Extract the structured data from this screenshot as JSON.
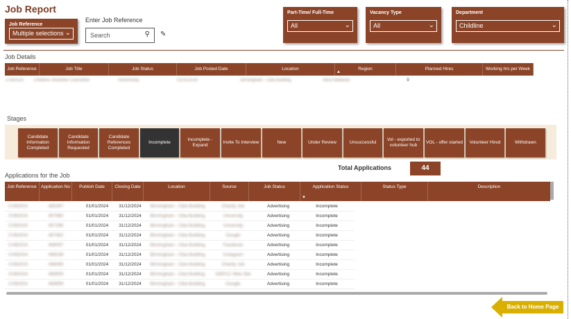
{
  "page": {
    "title": "Job Report",
    "back_label": "Back to Home Page"
  },
  "filters": {
    "job_reference": {
      "label": "Job Reference",
      "value": "Multiple selections"
    },
    "enter_reference_label": "Enter Job Reference",
    "search_placeholder": "Search",
    "part_time": {
      "label": "Part-Time/ Full-Time",
      "value": "All"
    },
    "vacancy_type": {
      "label": "Vacancy Type",
      "value": "All"
    },
    "department": {
      "label": "Department",
      "value": "Childline"
    }
  },
  "job_details": {
    "section_label": "Job Details",
    "columns": [
      "Job Reference",
      "Job Title",
      "Job Status",
      "Job Posted Date",
      "Location",
      "Region",
      "Planned Hires",
      "Working hrs per Week"
    ],
    "row": [
      "CVB2024",
      "Childline Volunteer Counsellor",
      "Advertising",
      "01/01/2024",
      "Birmingham - Ciba Building",
      "West Midlands",
      "0",
      ""
    ]
  },
  "stages": {
    "section_label": "Stages",
    "items": [
      "Candidate Information Completed",
      "Candidate Information Requested",
      "Candidate References Completed",
      "Incomplete",
      "Incomplete - Expand",
      "Invite To Interview",
      "New",
      "Under Review",
      "Unsuccessful",
      "Vol - exported to volunteer hub",
      "VOL - offer started",
      "Volunteer Hired",
      "Withdrawn"
    ],
    "selected": "Incomplete"
  },
  "applications": {
    "section_label": "Applications for the Job",
    "total_label": "Total Applications",
    "total_value": "44",
    "columns": [
      "Job Reference",
      "Application No",
      "Publish Date",
      "Closing Date",
      "Location",
      "Source",
      "Job Status",
      "Application Status",
      "Status Type",
      "Description"
    ],
    "rows": [
      [
        "CVB2024",
        "465497",
        "01/01/2024",
        "31/12/2024",
        "Birmingham - Ciba Building",
        "Charity Job",
        "Advertising",
        "Incomplete",
        "",
        ""
      ],
      [
        "CVB2024",
        "457980",
        "01/01/2024",
        "31/12/2024",
        "Birmingham - Ciba Building",
        "University",
        "Advertising",
        "Incomplete",
        "",
        ""
      ],
      [
        "CVB2024",
        "457285",
        "01/01/2024",
        "31/12/2024",
        "Birmingham - Ciba Building",
        "University",
        "Advertising",
        "Incomplete",
        "",
        ""
      ],
      [
        "CVB2024",
        "467462",
        "01/01/2024",
        "31/12/2024",
        "Birmingham - Ciba Building",
        "Google",
        "Advertising",
        "Incomplete",
        "",
        ""
      ],
      [
        "CVB2024",
        "468087",
        "01/01/2024",
        "31/12/2024",
        "Birmingham - Ciba Building",
        "Facebook",
        "Advertising",
        "Incomplete",
        "",
        ""
      ],
      [
        "CVB2024",
        "498248",
        "01/01/2024",
        "31/12/2024",
        "Birmingham - Ciba Building",
        "Instagram",
        "Advertising",
        "Incomplete",
        "",
        ""
      ],
      [
        "CVB2024",
        "496085",
        "01/01/2024",
        "31/12/2024",
        "Birmingham - Ciba Building",
        "Charity Job",
        "Advertising",
        "Incomplete",
        "",
        ""
      ],
      [
        "CVB2024",
        "469955",
        "01/01/2024",
        "31/12/2024",
        "Birmingham - Ciba Building",
        "NSPCC Web Site",
        "Advertising",
        "Incomplete",
        "",
        ""
      ],
      [
        "CVB2024",
        "469959",
        "01/01/2024",
        "31/12/2024",
        "Birmingham - Ciba Building",
        "Google",
        "Advertising",
        "Incomplete",
        "",
        ""
      ]
    ]
  },
  "colors": {
    "brand": "#8b4428",
    "selected_stage": "#333333",
    "back_button": "#d9b000",
    "stage_band": "#f5ecdc"
  }
}
